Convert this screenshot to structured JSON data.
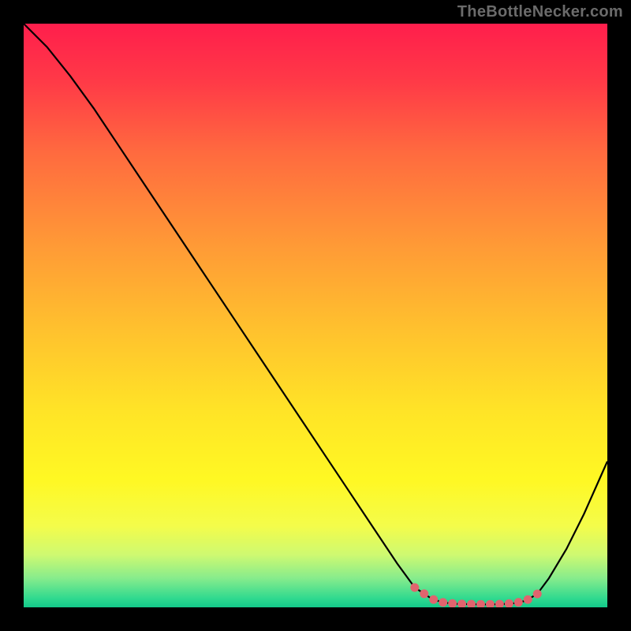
{
  "watermark": "TheBottleNecker.com",
  "chart_data": {
    "type": "line",
    "title": "",
    "xlabel": "",
    "ylabel": "",
    "xlim": [
      0,
      100
    ],
    "ylim": [
      0,
      100
    ],
    "x": [
      0,
      4,
      8,
      12,
      16,
      20,
      24,
      28,
      32,
      36,
      40,
      44,
      48,
      52,
      56,
      60,
      64,
      67,
      70,
      72,
      74,
      76,
      78,
      80,
      82,
      84,
      86,
      88,
      90,
      93,
      96,
      100
    ],
    "y": [
      100,
      96,
      91,
      85.5,
      79.5,
      73.5,
      67.5,
      61.5,
      55.5,
      49.5,
      43.5,
      37.5,
      31.5,
      25.5,
      19.5,
      13.5,
      7.5,
      3.4,
      1.4,
      0.8,
      0.6,
      0.55,
      0.5,
      0.5,
      0.55,
      0.7,
      1.1,
      2.3,
      5,
      10,
      16,
      25
    ],
    "highlight_range_x": [
      67,
      88
    ],
    "background_gradient": {
      "stops": [
        {
          "pos": 0.0,
          "color": "#ff1e4c"
        },
        {
          "pos": 0.1,
          "color": "#ff3a47"
        },
        {
          "pos": 0.22,
          "color": "#ff6a3f"
        },
        {
          "pos": 0.38,
          "color": "#ff9a36"
        },
        {
          "pos": 0.52,
          "color": "#ffc02e"
        },
        {
          "pos": 0.66,
          "color": "#ffe327"
        },
        {
          "pos": 0.78,
          "color": "#fff823"
        },
        {
          "pos": 0.86,
          "color": "#f4fc4a"
        },
        {
          "pos": 0.91,
          "color": "#cef971"
        },
        {
          "pos": 0.95,
          "color": "#87ec8c"
        },
        {
          "pos": 0.985,
          "color": "#2fd98f"
        },
        {
          "pos": 1.0,
          "color": "#13c98a"
        }
      ]
    },
    "marker_color": "#e0646e",
    "line_color": "#000000"
  }
}
